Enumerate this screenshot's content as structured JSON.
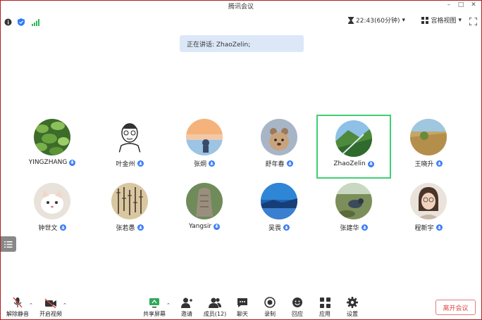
{
  "window": {
    "title": "腾讯会议",
    "controls": [
      "minimize-icon",
      "maximize-icon",
      "close-icon"
    ]
  },
  "status": {
    "timer": "22:43(60分钟)",
    "view_mode": "宫格视图"
  },
  "speaking": {
    "text": "正在讲话: ZhaoZelin;"
  },
  "participants": [
    {
      "name": "YINGZHANG"
    },
    {
      "name": "叶金州"
    },
    {
      "name": "张炯"
    },
    {
      "name": "舒年春"
    },
    {
      "name": "ZhaoZelin",
      "active": true
    },
    {
      "name": "王晓升"
    },
    {
      "name": "钟世文"
    },
    {
      "name": "张若愚"
    },
    {
      "name": "Yangsir"
    },
    {
      "name": "吴畏"
    },
    {
      "name": "张建华"
    },
    {
      "name": "程新宇"
    }
  ],
  "toolbar": {
    "unmute": "解除静音",
    "video": "开启视频",
    "share": "共享屏幕",
    "invite": "邀请",
    "members": "成员(12)",
    "chat": "聊天",
    "record": "录制",
    "react": "回应",
    "apps": "应用",
    "settings": "设置",
    "leave": "离开会议"
  },
  "colors": {
    "accent": "#3d7df5",
    "active_border": "#3ecf72",
    "leave": "#e04545",
    "speaking_bg": "#dce8f8"
  }
}
